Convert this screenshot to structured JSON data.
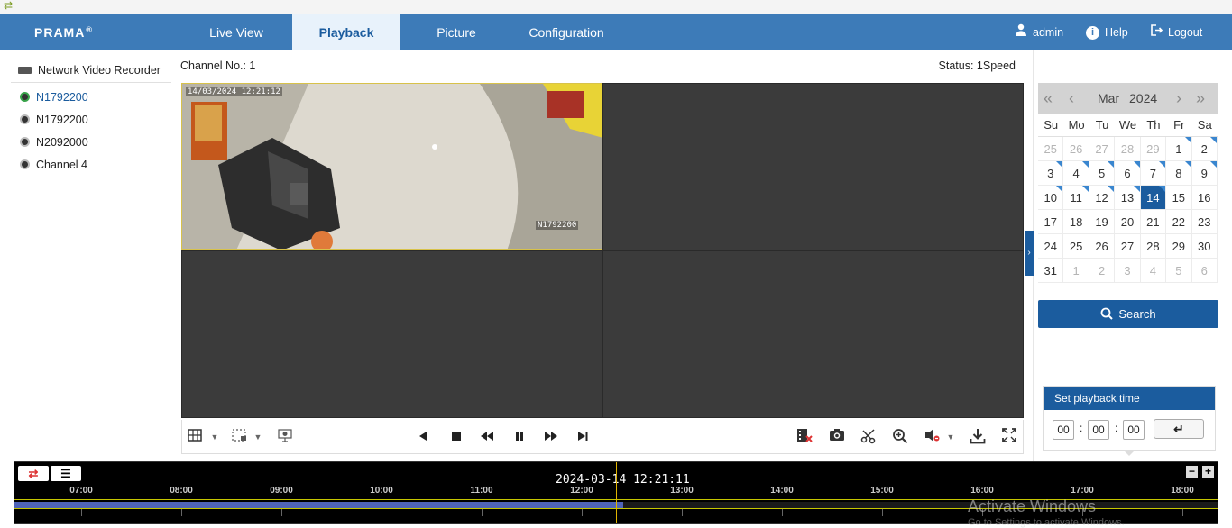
{
  "brand": {
    "logo": "PRAMA",
    "logo_mark": "®"
  },
  "nav": {
    "tabs": [
      {
        "label": "Live View",
        "active": false
      },
      {
        "label": "Playback",
        "active": true
      },
      {
        "label": "Picture",
        "active": false
      },
      {
        "label": "Configuration",
        "active": false
      }
    ],
    "user": {
      "label": "admin",
      "icon": "user-icon"
    },
    "help": {
      "label": "Help",
      "icon": "help-icon"
    },
    "logout": {
      "label": "Logout",
      "icon": "logout-icon"
    }
  },
  "sidebar": {
    "root": {
      "label": "Network Video Recorder",
      "icon": "nvr-icon"
    },
    "cameras": [
      {
        "label": "N1792200",
        "active": true
      },
      {
        "label": "N1792200",
        "active": false
      },
      {
        "label": "N2092000",
        "active": false
      },
      {
        "label": "Channel 4",
        "active": false
      }
    ]
  },
  "player": {
    "channel_label": "Channel No.: 1",
    "status_label": "Status: 1Speed",
    "pane1": {
      "osd_time": "14/03/2024 12:21:12",
      "osd_name": "N1792200"
    }
  },
  "controls": {
    "left": [
      "layout-grid-icon",
      "dropdown-arrow-icon",
      "window-select-icon",
      "dropdown-arrow-icon",
      "dewarp-icon"
    ],
    "center": [
      "reverse-play-icon",
      "stop-icon",
      "slow-down-icon",
      "pause-icon",
      "speed-up-icon",
      "single-frame-icon"
    ],
    "right": [
      "stop-all-icon",
      "capture-icon",
      "clip-icon",
      "digital-zoom-icon",
      "audio-muted-icon",
      "download-icon",
      "fullscreen-icon"
    ]
  },
  "calendar": {
    "month": "Mar",
    "year": "2024",
    "weekdays": [
      "Su",
      "Mo",
      "Tu",
      "We",
      "Th",
      "Fr",
      "Sa"
    ],
    "days": [
      {
        "d": "25",
        "other": true,
        "rec": false
      },
      {
        "d": "26",
        "other": true,
        "rec": false
      },
      {
        "d": "27",
        "other": true,
        "rec": false
      },
      {
        "d": "28",
        "other": true,
        "rec": false
      },
      {
        "d": "29",
        "other": true,
        "rec": false
      },
      {
        "d": "1",
        "other": false,
        "rec": true
      },
      {
        "d": "2",
        "other": false,
        "rec": true
      },
      {
        "d": "3",
        "other": false,
        "rec": true
      },
      {
        "d": "4",
        "other": false,
        "rec": true
      },
      {
        "d": "5",
        "other": false,
        "rec": true
      },
      {
        "d": "6",
        "other": false,
        "rec": true
      },
      {
        "d": "7",
        "other": false,
        "rec": true
      },
      {
        "d": "8",
        "other": false,
        "rec": true
      },
      {
        "d": "9",
        "other": false,
        "rec": true
      },
      {
        "d": "10",
        "other": false,
        "rec": true
      },
      {
        "d": "11",
        "other": false,
        "rec": true
      },
      {
        "d": "12",
        "other": false,
        "rec": true
      },
      {
        "d": "13",
        "other": false,
        "rec": true
      },
      {
        "d": "14",
        "other": false,
        "rec": true,
        "selected": true
      },
      {
        "d": "15",
        "other": false,
        "rec": false
      },
      {
        "d": "16",
        "other": false,
        "rec": false
      },
      {
        "d": "17",
        "other": false,
        "rec": false
      },
      {
        "d": "18",
        "other": false,
        "rec": false
      },
      {
        "d": "19",
        "other": false,
        "rec": false
      },
      {
        "d": "20",
        "other": false,
        "rec": false
      },
      {
        "d": "21",
        "other": false,
        "rec": false
      },
      {
        "d": "22",
        "other": false,
        "rec": false
      },
      {
        "d": "23",
        "other": false,
        "rec": false
      },
      {
        "d": "24",
        "other": false,
        "rec": false
      },
      {
        "d": "25",
        "other": false,
        "rec": false
      },
      {
        "d": "26",
        "other": false,
        "rec": false
      },
      {
        "d": "27",
        "other": false,
        "rec": false
      },
      {
        "d": "28",
        "other": false,
        "rec": false
      },
      {
        "d": "29",
        "other": false,
        "rec": false
      },
      {
        "d": "30",
        "other": false,
        "rec": false
      },
      {
        "d": "31",
        "other": false,
        "rec": false
      },
      {
        "d": "1",
        "other": true,
        "rec": false
      },
      {
        "d": "2",
        "other": true,
        "rec": false
      },
      {
        "d": "3",
        "other": true,
        "rec": false
      },
      {
        "d": "4",
        "other": true,
        "rec": false
      },
      {
        "d": "5",
        "other": true,
        "rec": false
      },
      {
        "d": "6",
        "other": true,
        "rec": false
      }
    ],
    "search_label": "Search"
  },
  "playback_time": {
    "title": "Set playback time",
    "hh": "00",
    "mm": "00",
    "ss": "00",
    "colon": ":",
    "enter_icon": "enter-icon"
  },
  "timeline": {
    "current": "2024-03-14 12:21:11",
    "ticks": [
      "07:00",
      "08:00",
      "09:00",
      "10:00",
      "11:00",
      "12:00",
      "13:00",
      "14:00",
      "15:00",
      "16:00",
      "17:00",
      "18:00"
    ],
    "zoom_out": "−",
    "zoom_in": "+"
  },
  "watermark": {
    "line1": "Activate Windows",
    "line2": "Go to Settings to activate Windows."
  }
}
